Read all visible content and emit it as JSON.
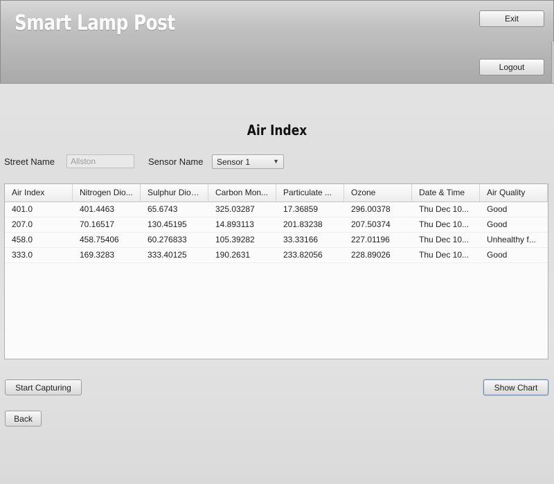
{
  "header": {
    "app_title": "Smart Lamp Post",
    "exit_label": "Exit",
    "logout_label": "Logout"
  },
  "main": {
    "section_title": "Air Index",
    "street_label": "Street Name",
    "street_value": "Allston",
    "sensor_label": "Sensor Name",
    "sensor_selected": "Sensor 1"
  },
  "table": {
    "columns": [
      "Air Index",
      "Nitrogen Dio...",
      "Sulphur Diox...",
      "Carbon Mon...",
      "Particulate ...",
      "Ozone",
      "Date & Time",
      "Air Quality"
    ],
    "rows": [
      [
        "401.0",
        "401.4463",
        "65.6743",
        "325.03287",
        "17.36859",
        "296.00378",
        "Thu Dec 10...",
        "Good"
      ],
      [
        "207.0",
        "70.16517",
        "130.45195",
        "14.893113",
        "201.83238",
        "207.50374",
        "Thu Dec 10...",
        "Good"
      ],
      [
        "458.0",
        "458.75406",
        "60.276833",
        "105.39282",
        "33.33166",
        "227.01196",
        "Thu Dec 10...",
        "Unhealthy f..."
      ],
      [
        "333.0",
        "169.3283",
        "333.40125",
        "190.2631",
        "233.82056",
        "228.89026",
        "Thu Dec 10...",
        "Good"
      ]
    ]
  },
  "footer": {
    "start_label": "Start Capturing",
    "chart_label": "Show Chart",
    "back_label": "Back"
  }
}
